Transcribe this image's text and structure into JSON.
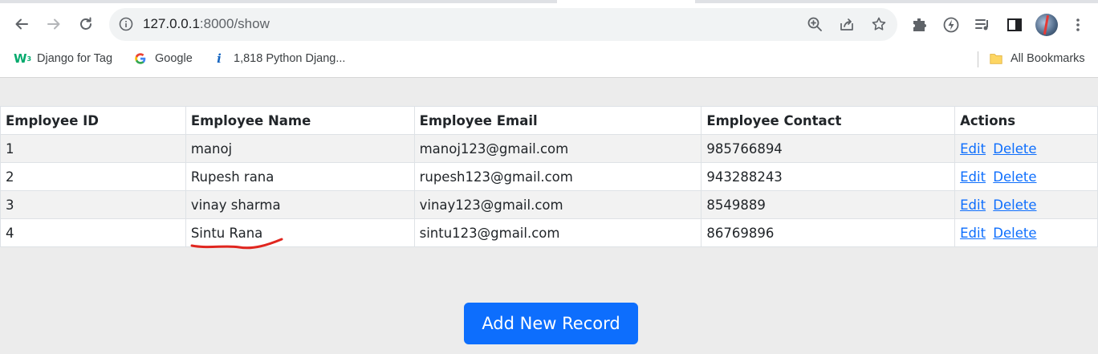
{
  "browser": {
    "url_host": "127.0.0.1",
    "url_rest": ":8000/show",
    "nav_icons": [
      "back-arrow-icon",
      "forward-arrow-icon",
      "reload-icon"
    ],
    "omnibox_icons": [
      "zoom-icon",
      "share-icon",
      "bookmark-star-icon"
    ],
    "toolbar_icons": [
      "extensions-icon",
      "lightning-icon",
      "media-queue-icon",
      "side-panel-icon",
      "profile-avatar",
      "more-menu-icon"
    ]
  },
  "bookmarks": {
    "items": [
      {
        "label": "Django for Tag",
        "icon": "w3schools-icon"
      },
      {
        "label": "Google",
        "icon": "google-icon"
      },
      {
        "label": "1,818 Python Djang...",
        "icon": "info-logo-icon"
      }
    ],
    "all_bookmarks": {
      "label": "All Bookmarks",
      "icon": "folder-icon"
    }
  },
  "table": {
    "headers": [
      "Employee ID",
      "Employee Name",
      "Employee Email",
      "Employee Contact",
      "Actions"
    ],
    "rows": [
      {
        "id": "1",
        "name": "manoj",
        "email": "manoj123@gmail.com",
        "contact": "985766894"
      },
      {
        "id": "2",
        "name": "Rupesh rana",
        "email": "rupesh123@gmail.com",
        "contact": "943288243"
      },
      {
        "id": "3",
        "name": "vinay sharma",
        "email": "vinay123@gmail.com",
        "contact": "8549889"
      },
      {
        "id": "4",
        "name": "Sintu Rana",
        "email": "sintu123@gmail.com",
        "contact": "86769896"
      }
    ],
    "edit_label": "Edit",
    "delete_label": "Delete"
  },
  "add_button_label": "Add New Record",
  "colors": {
    "primary": "#0d6efd",
    "annotation": "#e0261f"
  }
}
